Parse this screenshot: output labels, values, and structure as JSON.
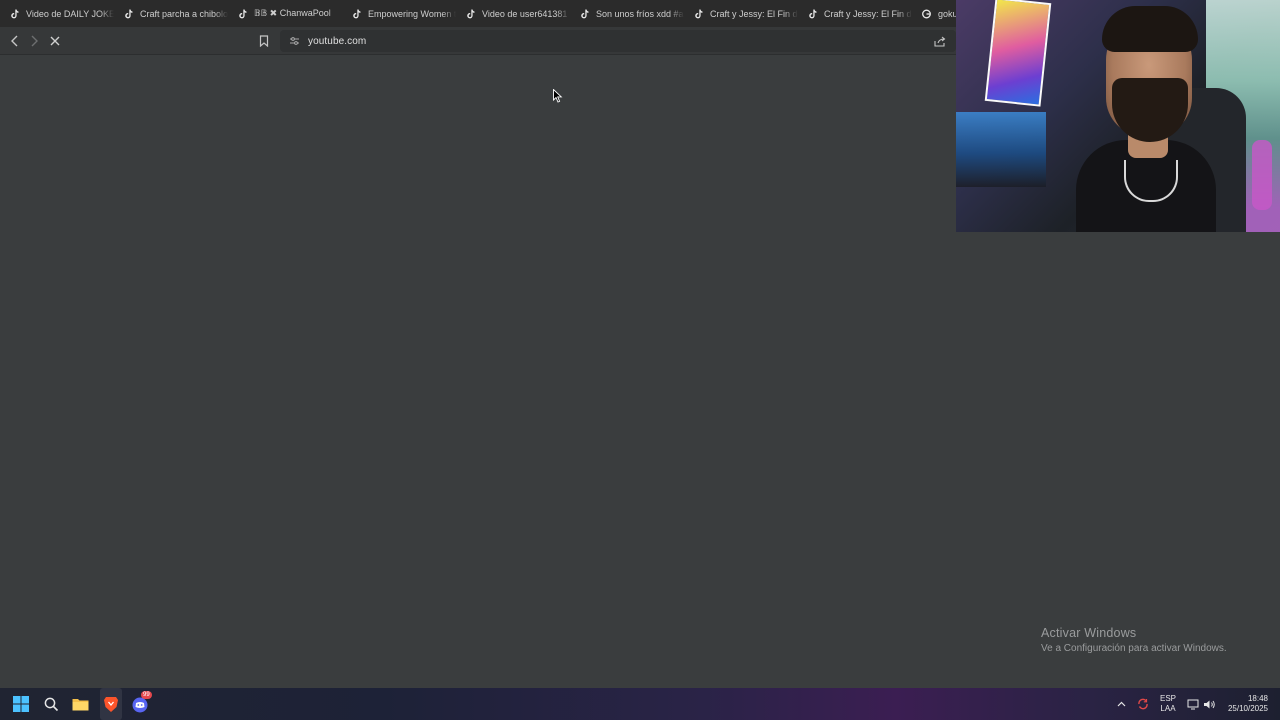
{
  "browser": {
    "tabs": [
      {
        "label": "Video de DAILY JOKES",
        "icon": "tiktok-icon"
      },
      {
        "label": "Craft parcha a chibolo",
        "icon": "tiktok-icon"
      },
      {
        "label": "𝔹𝔹 ✖ ChanwaPool",
        "icon": "tiktok-icon"
      },
      {
        "label": "Empowering Women t",
        "icon": "tiktok-icon"
      },
      {
        "label": "Video de user641381",
        "icon": "tiktok-icon"
      },
      {
        "label": "Son unos fríos xdd #ar",
        "icon": "tiktok-icon"
      },
      {
        "label": "Craft y Jessy: El Fin de",
        "icon": "tiktok-icon"
      },
      {
        "label": "Craft y Jessy: El Fin de",
        "icon": "tiktok-icon"
      },
      {
        "label": "goku",
        "icon": "google-icon"
      }
    ],
    "address": {
      "url": "youtube.com"
    }
  },
  "watermark": {
    "title": "Activar Windows",
    "subtitle": "Ve a Configuración para activar Windows."
  },
  "taskbar": {
    "discord_badge": "99",
    "tray": {
      "lang_top": "ESP",
      "lang_bottom": "LAA",
      "time": "18:48",
      "date": "25/10/2025"
    }
  },
  "colors": {
    "page_bg": "#3a3d3e",
    "tabstrip_bg": "#2b2b2b",
    "toolbar_bg": "#363839"
  }
}
